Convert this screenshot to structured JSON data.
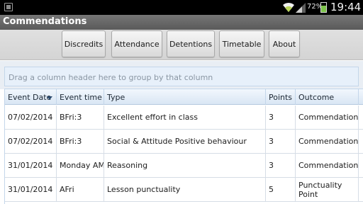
{
  "status": {
    "battery_percent": "72%",
    "battery_level": 0.72,
    "time": "19:44"
  },
  "app": {
    "title": "Commendations"
  },
  "nav": {
    "buttons": [
      "Discredits",
      "Attendance",
      "Detentions",
      "Timetable",
      "About"
    ]
  },
  "grid": {
    "group_hint": "Drag a column header here to group by that column",
    "columns": [
      "Event Date",
      "Event time",
      "Type",
      "Points",
      "Outcome"
    ],
    "sorted_column": "Event Date",
    "rows": [
      {
        "date": "07/02/2014",
        "time": "BFri:3",
        "type": "Excellent effort in class",
        "points": "3",
        "outcome": "Commendation"
      },
      {
        "date": "07/02/2014",
        "time": "BFri:3",
        "type": "Social & Attitude Positive behaviour",
        "points": "3",
        "outcome": "Commendation"
      },
      {
        "date": "31/01/2014",
        "time": "Monday AM",
        "type": "Reasoning",
        "points": "3",
        "outcome": "Commendation"
      },
      {
        "date": "31/01/2014",
        "time": "AFri",
        "type": "Lesson punctuality",
        "points": "5",
        "outcome": "Punctuality Point"
      }
    ]
  },
  "colors": {
    "status_bar": "#000000",
    "title_bar": "#666666",
    "grid_header": "#dde8f5",
    "grid_border": "#c4d6ea"
  }
}
